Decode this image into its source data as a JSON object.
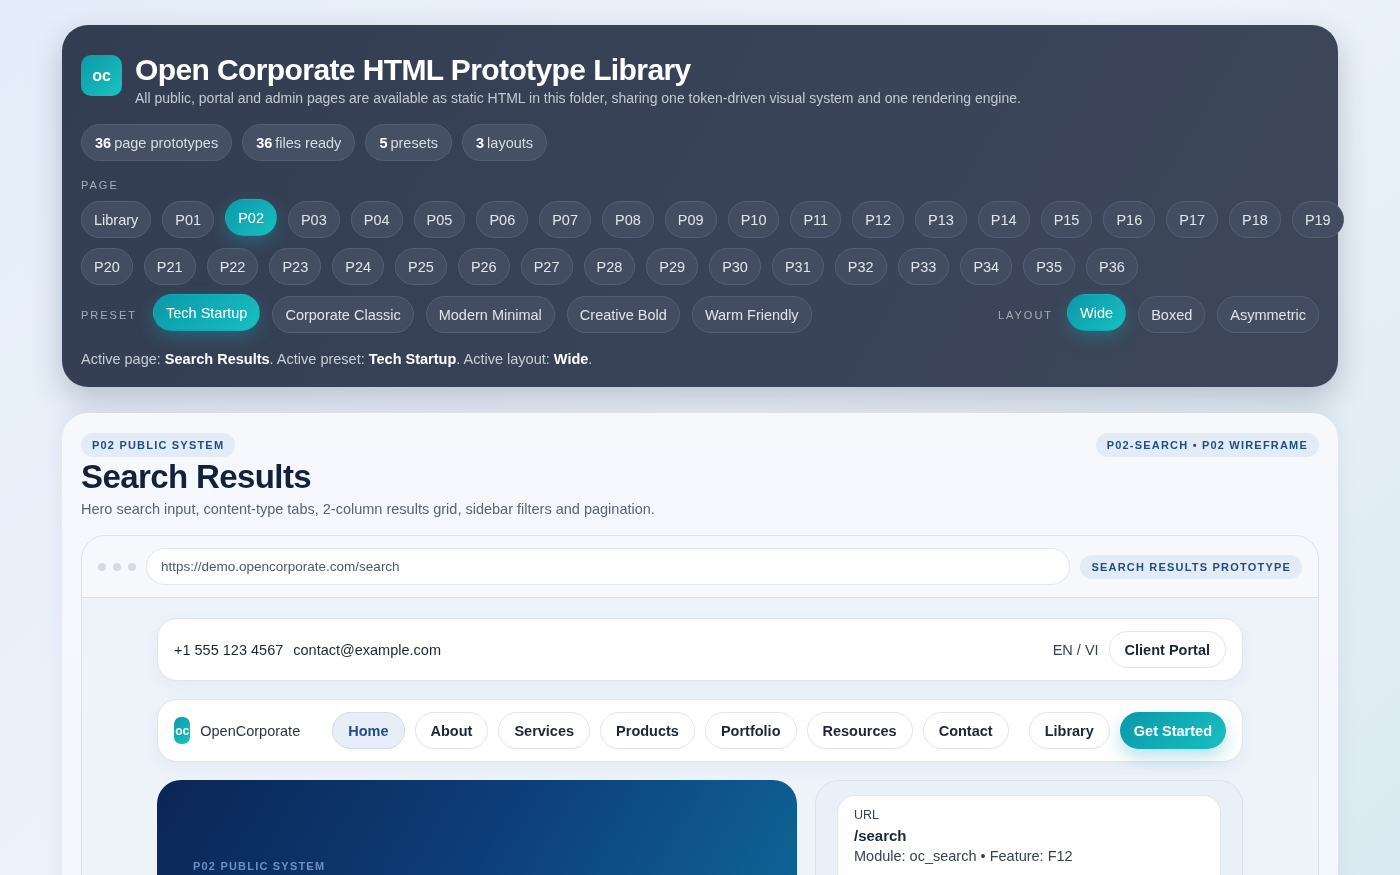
{
  "library": {
    "logo": "oc",
    "title": "Open Corporate HTML Prototype Library",
    "subtitle": "All public, portal and admin pages are available as static HTML in this folder, sharing one token-driven visual system and one rendering engine.",
    "stats": [
      "**36** page prototypes",
      "**36** files ready",
      "**5** presets",
      "**3** layouts"
    ],
    "page_label": "PAGE",
    "page_rows": [
      [
        {
          "label": "Library",
          "selected": false
        },
        {
          "label": "P01",
          "selected": false
        },
        {
          "label": "P02",
          "selected": true
        },
        {
          "label": "P03",
          "selected": false
        },
        {
          "label": "P04",
          "selected": false
        },
        {
          "label": "P05",
          "selected": false
        },
        {
          "label": "P06",
          "selected": false
        },
        {
          "label": "P07",
          "selected": false
        },
        {
          "label": "P08",
          "selected": false
        },
        {
          "label": "P09",
          "selected": false
        },
        {
          "label": "P10",
          "selected": false
        },
        {
          "label": "P11",
          "selected": false
        },
        {
          "label": "P12",
          "selected": false
        },
        {
          "label": "P13",
          "selected": false
        },
        {
          "label": "P14",
          "selected": false
        },
        {
          "label": "P15",
          "selected": false
        },
        {
          "label": "P16",
          "selected": false
        },
        {
          "label": "P17",
          "selected": false
        },
        {
          "label": "P18",
          "selected": false
        },
        {
          "label": "P19",
          "selected": false
        }
      ],
      [
        {
          "label": "P20",
          "selected": false
        },
        {
          "label": "P21",
          "selected": false
        },
        {
          "label": "P22",
          "selected": false
        },
        {
          "label": "P23",
          "selected": false
        },
        {
          "label": "P24",
          "selected": false
        },
        {
          "label": "P25",
          "selected": false
        },
        {
          "label": "P26",
          "selected": false
        },
        {
          "label": "P27",
          "selected": false
        },
        {
          "label": "P28",
          "selected": false
        },
        {
          "label": "P29",
          "selected": false
        },
        {
          "label": "P30",
          "selected": false
        },
        {
          "label": "P31",
          "selected": false
        },
        {
          "label": "P32",
          "selected": false
        },
        {
          "label": "P33",
          "selected": false
        },
        {
          "label": "P34",
          "selected": false
        },
        {
          "label": "P35",
          "selected": false
        },
        {
          "label": "P36",
          "selected": false
        }
      ]
    ],
    "preset_label": "PRESET",
    "presets": [
      {
        "label": "Tech Startup",
        "selected": true
      },
      {
        "label": "Corporate Classic",
        "selected": false
      },
      {
        "label": "Modern Minimal",
        "selected": false
      },
      {
        "label": "Creative Bold",
        "selected": false
      },
      {
        "label": "Warm Friendly",
        "selected": false
      }
    ],
    "layout_label": "LAYOUT",
    "layouts": [
      {
        "label": "Wide",
        "selected": true
      },
      {
        "label": "Boxed",
        "selected": false
      },
      {
        "label": "Asymmetric",
        "selected": false
      }
    ],
    "status": "Active page: **Search Results**. Active preset: **Tech Startup**. Active layout: **Wide**."
  },
  "preview": {
    "badge": "P02 PUBLIC SYSTEM",
    "tag": "P02-SEARCH • P02 WIREFRAME",
    "title": "Search Results",
    "description": "Hero search input, content-type tabs, 2-column results grid, sidebar filters and pagination.",
    "browser": {
      "url": "https://demo.opencorporate.com/search",
      "badge": "SEARCH RESULTS PROTOTYPE"
    },
    "topbar": {
      "phone": "+1 555 123 4567",
      "email": "contact@example.com",
      "language": "EN / VI",
      "portal_button": "Client Portal"
    },
    "nav": {
      "logo": "oc",
      "brand": "OpenCorporate",
      "links": [
        {
          "label": "Home",
          "selected": true
        },
        {
          "label": "About",
          "selected": false
        },
        {
          "label": "Services",
          "selected": false
        },
        {
          "label": "Products",
          "selected": false
        },
        {
          "label": "Portfolio",
          "selected": false
        },
        {
          "label": "Resources",
          "selected": false
        },
        {
          "label": "Contact",
          "selected": false
        }
      ],
      "library_button": "Library",
      "cta": "Get Started"
    },
    "hero": {
      "eyebrow": "P02 PUBLIC SYSTEM"
    },
    "info": {
      "label": "URL",
      "path": "/search",
      "meta": "Module: oc_search • Feature: F12"
    }
  }
}
